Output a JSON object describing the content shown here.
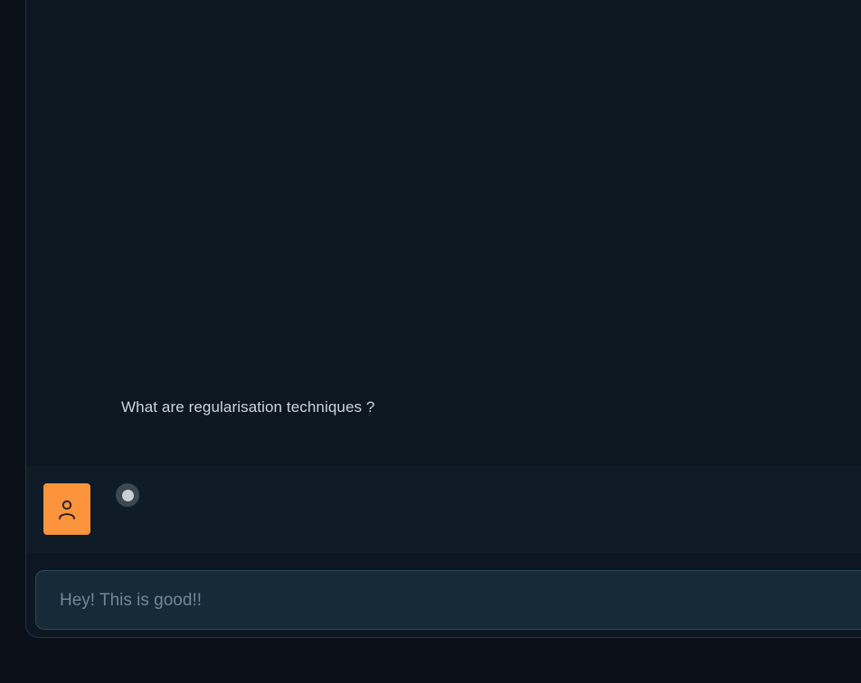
{
  "chat": {
    "messages": [
      {
        "role": "user",
        "text": "What are regularisation techniques ?"
      }
    ],
    "bot_status": "typing"
  },
  "composer": {
    "placeholder": "Hey! This is good!!",
    "value": ""
  },
  "icons": {
    "avatar": "user-icon",
    "typing": "loading-dot-icon"
  },
  "colors": {
    "background": "#0b1118",
    "panel": "#0c1721",
    "bot_row": "#0f1c27",
    "avatar_accent": "#fb923c",
    "input_bg": "#172a38",
    "input_border": "#2c4a5e"
  }
}
